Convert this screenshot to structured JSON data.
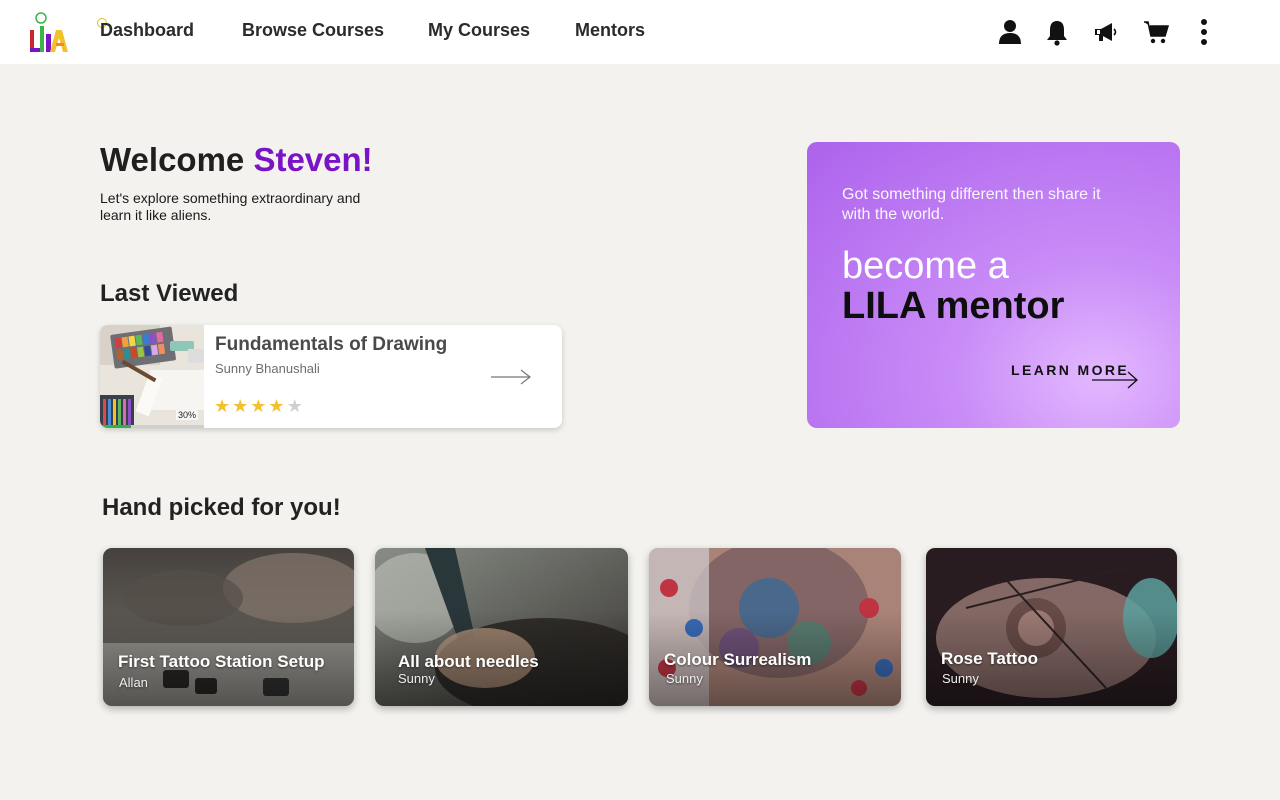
{
  "nav": {
    "logo_text": "LILA",
    "links": [
      {
        "label": "Dashboard"
      },
      {
        "label": "Browse Courses"
      },
      {
        "label": "My Courses"
      },
      {
        "label": "Mentors"
      }
    ],
    "icons": [
      "user-icon",
      "bell-icon",
      "megaphone-icon",
      "cart-icon",
      "more-vertical-icon"
    ]
  },
  "welcome": {
    "greeting": "Welcome",
    "name": "Steven!",
    "subtitle": "Let's explore something extraordinary and learn it like aliens.",
    "name_color": "#7a12c6"
  },
  "last_viewed": {
    "heading": "Last Viewed",
    "course": {
      "title": "Fundamentals of Drawing",
      "author": "Sunny Bhanushali",
      "progress_label": "30%",
      "progress": 0.3,
      "rating": 4,
      "rating_max": 5
    }
  },
  "promo": {
    "subtitle": "Got something different then share it with the world.",
    "line1": "become a",
    "line2": "LILA mentor",
    "cta": "LEARN MORE"
  },
  "picks": {
    "heading": "Hand picked for you!",
    "cards": [
      {
        "title": "First Tattoo Station Setup",
        "author": "Allan"
      },
      {
        "title": "All about needles",
        "author": "Sunny"
      },
      {
        "title": "Colour Surrealism",
        "author": "Sunny"
      },
      {
        "title": "Rose Tattoo",
        "author": "Sunny"
      }
    ]
  },
  "colors": {
    "accent": "#7a12c6",
    "promo_bg": "#ac62ec",
    "star": "#f2c12e",
    "progress": "#2fb34a"
  }
}
